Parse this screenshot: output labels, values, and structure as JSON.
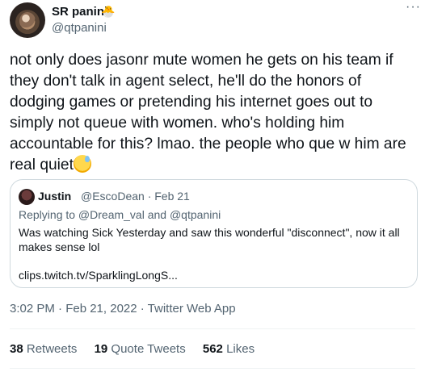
{
  "author": {
    "name": "SR panini",
    "badge_icon": "hatching-chick-icon",
    "handle": "@qtpanini"
  },
  "tweet": {
    "text": "not only does jasonr mute women he gets on his team if they don't talk in agent select, he'll do the honors of dodging games or pretending his internet goes out to simply not queue with women. who's holding him accountable for this? lmao. the people who que w him are real quiet",
    "emoji_icon": "sweat-smile-emoji-icon"
  },
  "quote": {
    "name": "Justin",
    "meta": "@EscoDean · Feb 21",
    "reply_to": "Replying to @Dream_val and @qtpanini",
    "body": "Was watching Sick Yesterday and saw this wonderful \"disconnect\", now it all makes sense lol",
    "link": "clips.twitch.tv/SparklingLongS..."
  },
  "timestamp": "3:02 PM · Feb 21, 2022 · Twitter Web App",
  "stats": {
    "retweets_count": "38",
    "retweets_label": "Retweets",
    "quotes_count": "19",
    "quotes_label": "Quote Tweets",
    "likes_count": "562",
    "likes_label": "Likes"
  }
}
